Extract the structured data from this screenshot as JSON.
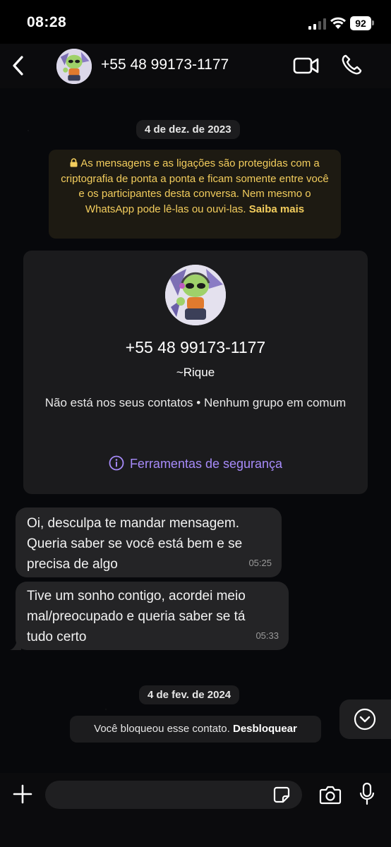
{
  "status_bar": {
    "time": "08:28",
    "battery": "92"
  },
  "header": {
    "contact_name": "+55 48 99173-1177"
  },
  "dates": {
    "first": "4 de dez. de 2023",
    "second": "4 de fev. de 2024"
  },
  "encryption_notice": {
    "text": "As mensagens e as ligações são protegidas com a criptografia de ponta a ponta e ficam somente entre você e os participantes desta conversa. Nem mesmo o WhatsApp pode lê-las ou ouvi-las.",
    "link": "Saiba mais"
  },
  "contact_card": {
    "number": "+55 48 99173-1177",
    "alias": "~Rique",
    "status": "Não está nos seus contatos • Nenhum grupo em comum",
    "tools": "Ferramentas de segurança"
  },
  "messages": [
    {
      "text_lines": [
        "Oi, desculpa te mandar mensagem.",
        "Queria saber se você está bem e se",
        "precisa de algo"
      ],
      "time": "05:25"
    },
    {
      "text_lines": [
        "Tive um sonho contigo, acordei meio",
        "mal/preocupado e queria saber se tá",
        "tudo certo"
      ],
      "time": "05:33"
    }
  ],
  "blocked": {
    "text": "Você bloqueou esse contato.",
    "action": "Desbloquear"
  },
  "input": {
    "value": ""
  },
  "colors": {
    "accent_purple": "#a78bfa",
    "notice_yellow": "#f3cd5d",
    "bubble": "#242426"
  },
  "icons": [
    "back-icon",
    "video-icon",
    "phone-icon",
    "lock-icon",
    "info-icon",
    "chevron-down-icon",
    "plus-icon",
    "sticker-icon",
    "camera-icon",
    "mic-icon"
  ]
}
